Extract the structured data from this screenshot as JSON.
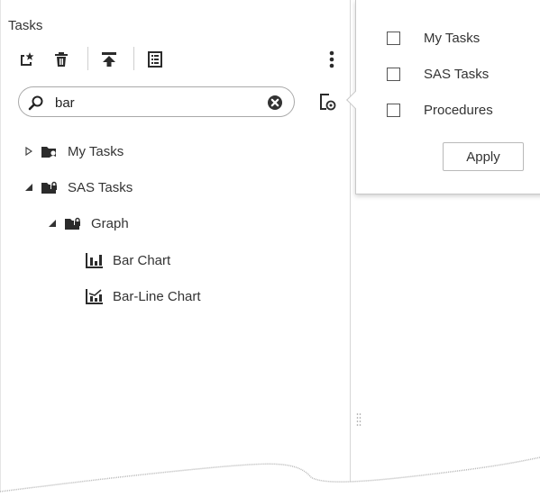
{
  "tasks_pane": {
    "title": "Tasks",
    "toolbar": [
      {
        "name": "new-task-icon"
      },
      {
        "name": "delete-icon"
      },
      {
        "name": "upload-icon"
      },
      {
        "name": "properties-icon"
      },
      {
        "name": "more-options-icon"
      }
    ],
    "search": {
      "value": "bar",
      "placeholder": ""
    },
    "tree": [
      {
        "label": "My Tasks",
        "expanded": false,
        "level": 0
      },
      {
        "label": "SAS Tasks",
        "expanded": true,
        "level": 0
      },
      {
        "label": "Graph",
        "expanded": true,
        "level": 1
      },
      {
        "label": "Bar Chart",
        "level": 2,
        "icon": "bar-chart-icon"
      },
      {
        "label": "Bar-Line Chart",
        "level": 2,
        "icon": "bar-line-chart-icon"
      }
    ]
  },
  "filter_panel": {
    "options": [
      {
        "label": "My Tasks",
        "checked": false
      },
      {
        "label": "SAS Tasks",
        "checked": false
      },
      {
        "label": "Procedures",
        "checked": false
      }
    ],
    "apply_label": "Apply"
  },
  "colors": {
    "text": "#333333",
    "border": "#c8c8c8",
    "icon": "#2b2b2b"
  }
}
